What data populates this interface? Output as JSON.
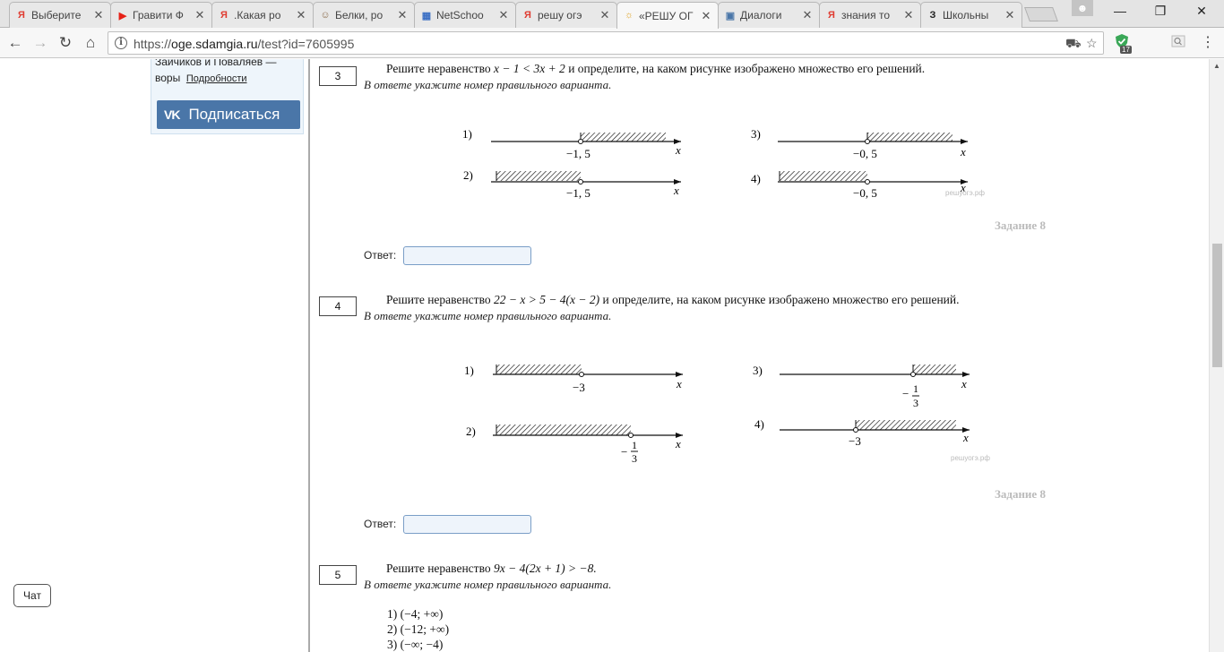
{
  "browser": {
    "tabs": [
      {
        "label": "Выберите",
        "favicon_text": "Я",
        "favicon_color": "#e03c31"
      },
      {
        "label": "Гравити Ф",
        "favicon_text": "▶",
        "favicon_color": "#e62117"
      },
      {
        "label": ".Какая ро",
        "favicon_text": "Я",
        "favicon_color": "#e03c31"
      },
      {
        "label": "Белки, ро",
        "favicon_text": "☺",
        "favicon_color": "#8a6a4a"
      },
      {
        "label": "NetSchoo",
        "favicon_text": "▦",
        "favicon_color": "#3a6fc4"
      },
      {
        "label": "решу огэ",
        "favicon_text": "Я",
        "favicon_color": "#e03c31"
      },
      {
        "label": "«РЕШУ ОГ",
        "favicon_text": "☼",
        "favicon_color": "#e0a52a"
      },
      {
        "label": "Диалоги",
        "favicon_text": "▣",
        "favicon_color": "#4a76a8"
      },
      {
        "label": "знания то",
        "favicon_text": "Я",
        "favicon_color": "#e03c31"
      },
      {
        "label": "Школьны",
        "favicon_text": "З",
        "favicon_color": "#222222"
      }
    ],
    "active_tab_index": 6,
    "url_scheme": "https://",
    "url_host": "oge.sdamgia.ru",
    "url_path": "/test?id=7605995",
    "extension_badge": "17"
  },
  "sidebar": {
    "text": "Зайчиков и Поваляев — воры",
    "link": "Подробности",
    "vk_logo": "VK",
    "vk_button": "Подписаться"
  },
  "chat_button": "Чат",
  "tasks": [
    {
      "number": "3",
      "text_before": "Решите неравенство ",
      "math": "x − 1 < 3x + 2",
      "text_after": " и определите, на каком рисунке изображено множество его решений.",
      "hint": "В ответе укажите номер правильного варианта.",
      "figure": {
        "options": [
          {
            "label": "1)",
            "point": "−1, 5"
          },
          {
            "label": "2)",
            "point": "−1, 5"
          },
          {
            "label": "3)",
            "point": "−0, 5"
          },
          {
            "label": "4)",
            "point": "−0, 5"
          }
        ],
        "axis_label": "x",
        "watermark": "решуогэ.рф"
      },
      "zadanie": "Задание 8",
      "answer_label": "Ответ:"
    },
    {
      "number": "4",
      "text_before": "Решите неравенство ",
      "math": "22 − x > 5 − 4(x − 2)",
      "text_after": " и определите, на каком рисунке изображено множество его решений.",
      "hint": "В ответе укажите номер правильного варианта.",
      "figure": {
        "options": [
          {
            "label": "1)",
            "point": "−3"
          },
          {
            "label": "2)",
            "point": "−",
            "frac_num": "1",
            "frac_den": "3"
          },
          {
            "label": "3)",
            "point": "−",
            "frac_num": "1",
            "frac_den": "3"
          },
          {
            "label": "4)",
            "point": "−3"
          }
        ],
        "axis_label": "x",
        "watermark": "решуогэ.рф"
      },
      "zadanie": "Задание 8",
      "answer_label": "Ответ:"
    },
    {
      "number": "5",
      "text_before": "Решите неравенство ",
      "math": "9x − 4(2x + 1) > −8.",
      "text_after": "",
      "hint": "В ответе укажите номер правильного варианта.",
      "options": [
        "1) (−4; +∞)",
        "2) (−12; +∞)",
        "3) (−∞; −4)"
      ]
    }
  ]
}
